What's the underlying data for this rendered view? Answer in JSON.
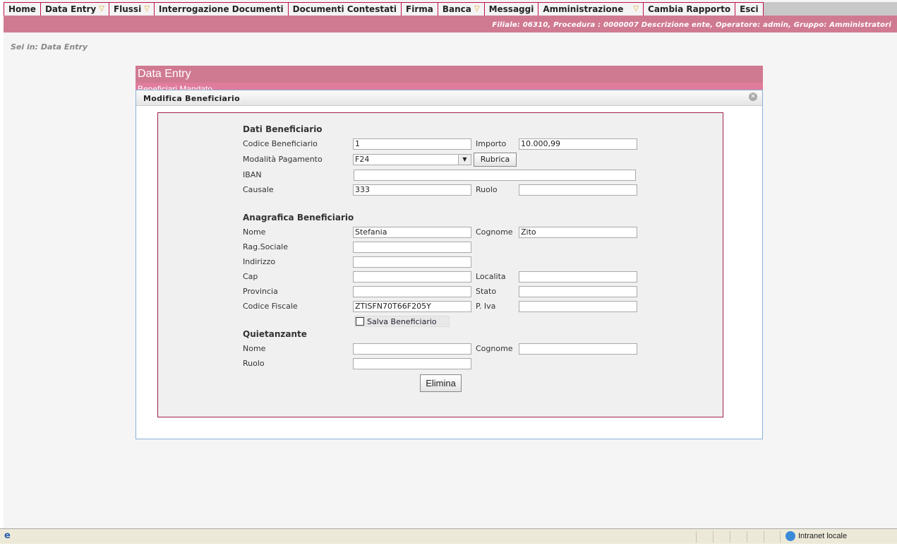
{
  "nav": [
    {
      "label": "Home",
      "dropdown": false
    },
    {
      "label": "Data Entry",
      "dropdown": true
    },
    {
      "label": "Flussi",
      "dropdown": true
    },
    {
      "label": "Interrogazione Documenti",
      "dropdown": false
    },
    {
      "label": "Documenti Contestati",
      "dropdown": false
    },
    {
      "label": "Firma",
      "dropdown": false
    },
    {
      "label": "Banca",
      "dropdown": true
    },
    {
      "label": "Messaggi",
      "dropdown": false
    },
    {
      "label": "Amministrazione",
      "dropdown": true
    },
    {
      "label": "Cambia Rapporto",
      "dropdown": false
    },
    {
      "label": "Esci",
      "dropdown": false
    }
  ],
  "info": "Filiale: 06310, Procedura : 0000007 Descrizione ente, Operatore: admin, Gruppo: Amministratori",
  "breadcrumb": "Sei in: Data Entry",
  "panel": {
    "title": "Data Entry",
    "subtitle": "Beneficiari Mandato"
  },
  "dialog": {
    "title": "Modifica Beneficiario",
    "dati": {
      "title": "Dati Beneficiario",
      "codice_label": "Codice Beneficiario",
      "codice": "1",
      "importo_label": "Importo",
      "importo": "10.000,99",
      "modalita_label": "Modalità Pagamento",
      "modalita": "F24",
      "rubrica": "Rubrica",
      "iban_label": "IBAN",
      "iban": "",
      "causale_label": "Causale",
      "causale": "333",
      "ruolo_label": "Ruolo",
      "ruolo": ""
    },
    "anagrafica": {
      "title": "Anagrafica Beneficiario",
      "nome_label": "Nome",
      "nome": "Stefania",
      "cognome_label": "Cognome",
      "cognome": "Zito",
      "rag_label": "Rag.Sociale",
      "rag": "",
      "indirizzo_label": "Indirizzo",
      "indirizzo": "",
      "cap_label": "Cap",
      "cap": "",
      "localita_label": "Localita",
      "localita": "",
      "provincia_label": "Provincia",
      "provincia": "",
      "stato_label": "Stato",
      "stato": "",
      "cf_label": "Codice Fiscale",
      "cf": "ZTISFN70T66F205Y",
      "piva_label": "P. Iva",
      "piva": "",
      "salva_label": "Salva Beneficiario",
      "salva_checked": false
    },
    "quietanzante": {
      "title": "Quietanzante",
      "nome_label": "Nome",
      "nome": "",
      "cognome_label": "Cognome",
      "cognome": "",
      "ruolo_label": "Ruolo",
      "ruolo": ""
    },
    "elimina": "Elimina"
  },
  "statusbar": {
    "zone": "Intranet locale"
  }
}
